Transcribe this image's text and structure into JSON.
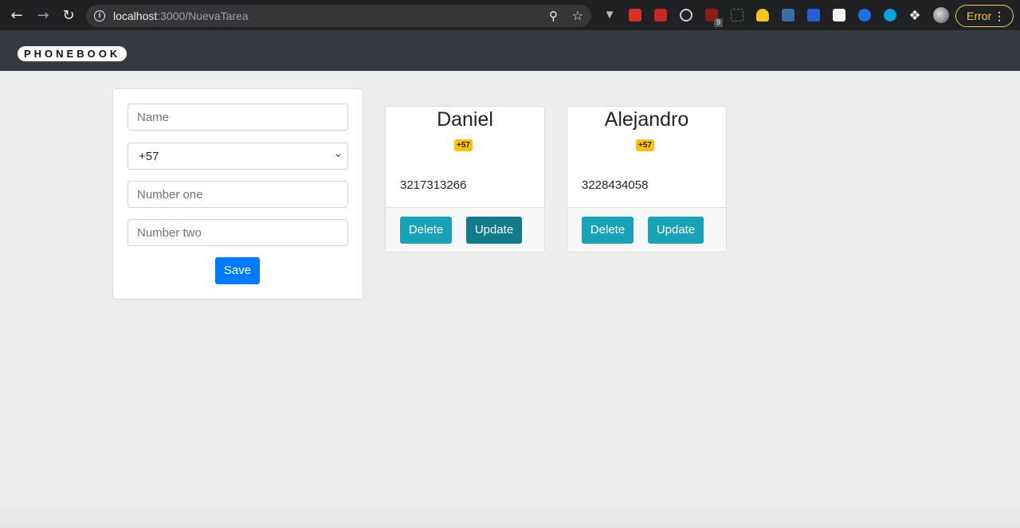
{
  "browser": {
    "url_host": "localhost",
    "url_path": ":3000/NuevaTarea",
    "error_label": "Error",
    "extension_badge": "9"
  },
  "navbar": {
    "brand": "PHONEBOOK"
  },
  "form": {
    "name_placeholder": "Name",
    "country_code_value": "+57",
    "number_one_placeholder": "Number one",
    "number_two_placeholder": "Number two",
    "save_label": "Save"
  },
  "contacts": [
    {
      "name": "Daniel",
      "code": "+57",
      "phone": "3217313266",
      "delete_label": "Delete",
      "update_label": "Update"
    },
    {
      "name": "Alejandro",
      "code": "+57",
      "phone": "3228434058",
      "delete_label": "Delete",
      "update_label": "Update"
    }
  ],
  "colors": {
    "primary": "#007bff",
    "info": "#17a2b8",
    "info_dark": "#117a8b",
    "warning": "#ffc107",
    "navbar": "#343a40"
  },
  "icons": {
    "back": "arrow-left-icon",
    "forward": "arrow-right-icon",
    "reload": "reload-icon",
    "info": "info-icon",
    "zoom": "zoom-icon",
    "bookmark": "star-icon",
    "menu": "kebab-icon"
  }
}
